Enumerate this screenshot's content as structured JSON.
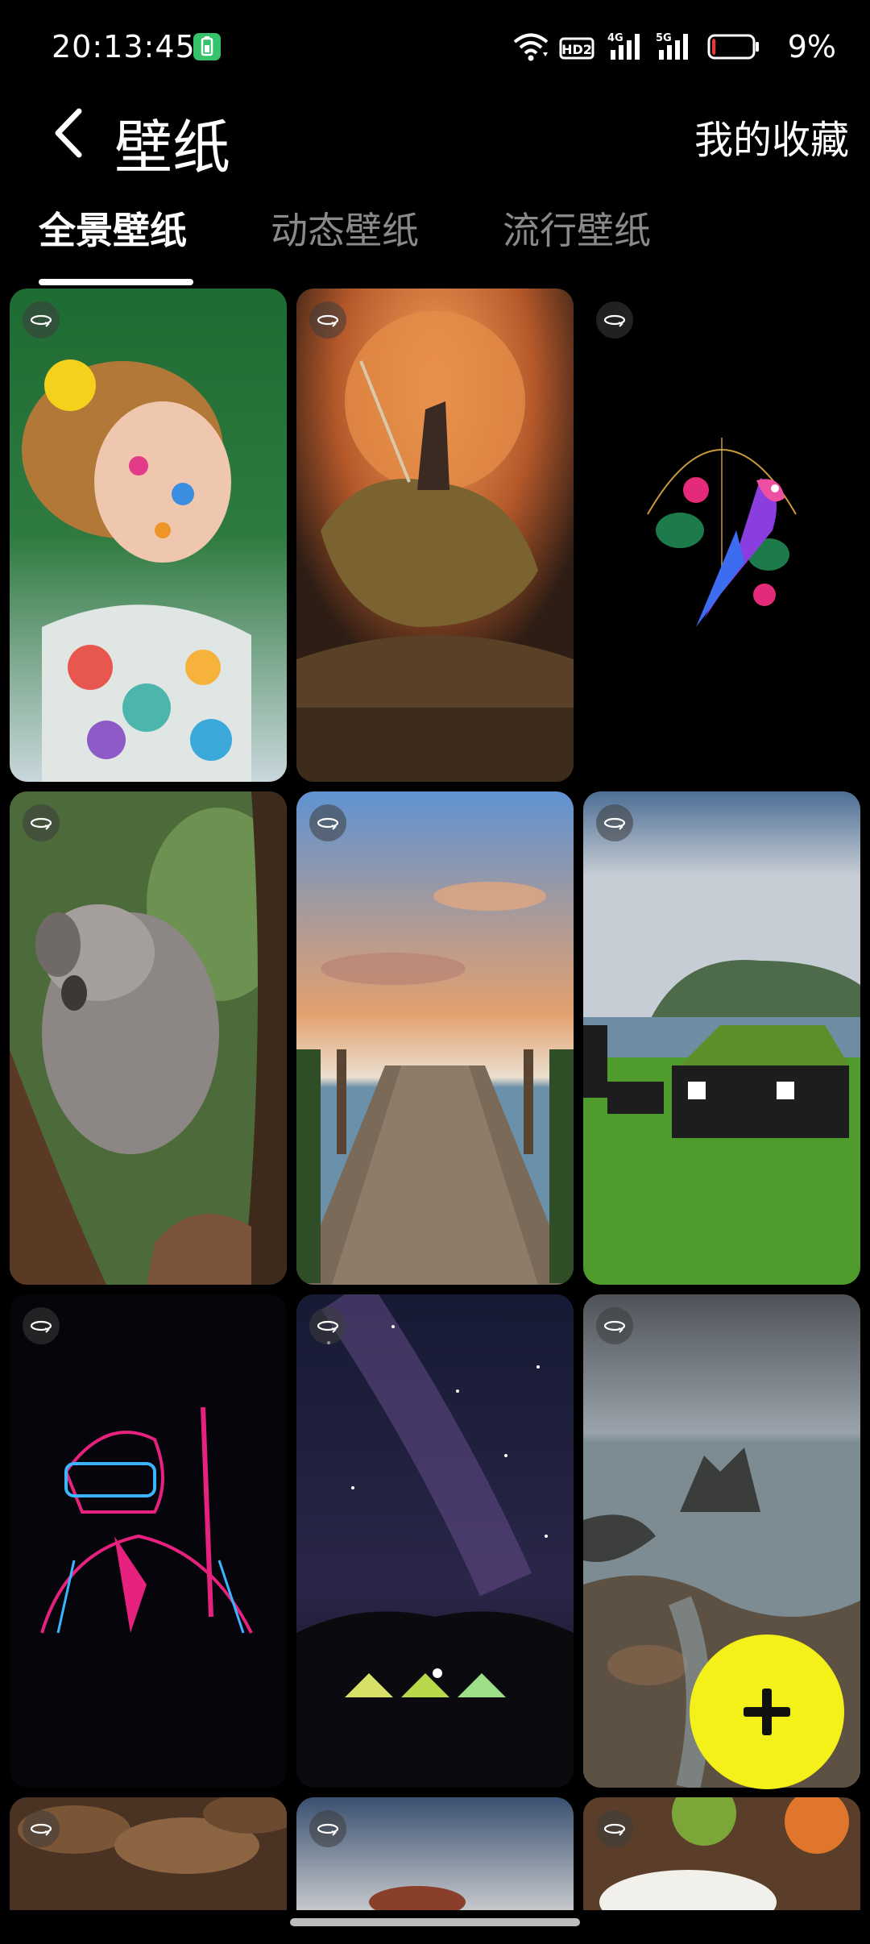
{
  "status_bar": {
    "time": "20:13:45",
    "battery_percent": "9%",
    "battery_level": 0.09,
    "icons": [
      "battery-saver-icon",
      "wifi-icon",
      "hd-volte-icon",
      "signal-4g-icon",
      "signal-5g-icon",
      "battery-icon"
    ],
    "network_labels": {
      "hd": "HD2",
      "g4": "4G",
      "g5": "5G"
    }
  },
  "app_bar": {
    "title": "壁纸",
    "favorites_label": "我的收藏"
  },
  "tabs": [
    {
      "label": "全景壁纸",
      "active": true
    },
    {
      "label": "动态壁纸",
      "active": false
    },
    {
      "label": "流行壁纸",
      "active": false
    }
  ],
  "wallpapers": [
    {
      "name": "child-painted-face",
      "icon": "panorama-icon"
    },
    {
      "name": "warrior-riding-beast",
      "icon": "panorama-icon"
    },
    {
      "name": "neon-parrot",
      "icon": "panorama-icon"
    },
    {
      "name": "koala-on-tree",
      "icon": "panorama-icon"
    },
    {
      "name": "wooden-pier-sunset",
      "icon": "panorama-icon"
    },
    {
      "name": "grass-roof-houses",
      "icon": "panorama-icon"
    },
    {
      "name": "neon-soldier",
      "icon": "panorama-icon"
    },
    {
      "name": "milky-way-camping",
      "icon": "panorama-icon"
    },
    {
      "name": "rocky-coast",
      "icon": "panorama-icon"
    },
    {
      "name": "autumn-leaves",
      "icon": "panorama-icon"
    },
    {
      "name": "blurred-scene",
      "icon": "panorama-icon"
    },
    {
      "name": "fruit-breakfast",
      "icon": "panorama-icon"
    }
  ],
  "fab": {
    "icon": "plus-icon",
    "color": "#f3f01a"
  },
  "colors": {
    "background": "#000000",
    "accent": "#f3f01a",
    "battery_low": "#e53935",
    "battery_saver": "#35c26b"
  }
}
